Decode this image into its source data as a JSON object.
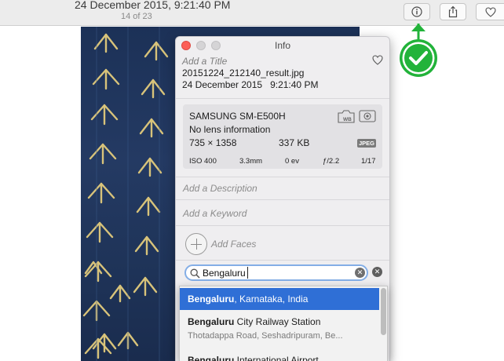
{
  "toolbar": {
    "date_title": "24 December 2015, 9:21:40 PM",
    "photo_count": "14 of 23",
    "info_icon": "info-icon",
    "share_icon": "share-icon",
    "favorite_icon": "heart-icon"
  },
  "info_panel": {
    "window_title": "Info",
    "add_title_placeholder": "Add a Title",
    "filename": "20151224_212140_result.jpg",
    "date": "24 December 2015   9:21:40 PM",
    "camera": {
      "model": "SAMSUNG SM-E500H",
      "lens": "No lens information",
      "dimensions": "735 × 1358",
      "file_size": "337 KB",
      "format": "JPEG",
      "iso": "ISO 400",
      "focal_length": "3.3mm",
      "exposure": "0 ev",
      "aperture": "ƒ/2.2",
      "shutter": "1/17"
    },
    "add_description_placeholder": "Add a Description",
    "add_keyword_placeholder": "Add a Keyword",
    "add_faces_label": "Add Faces",
    "location_search": {
      "value": "Bengaluru"
    }
  },
  "location_suggestions": [
    {
      "bold": "Bengaluru",
      "rest": ", Karnataka, India",
      "detail": ""
    },
    {
      "bold": "Bengaluru",
      "rest": " City Railway Station",
      "detail": "Thotadappa Road, Seshadripuram, Be..."
    },
    {
      "bold": "Bengaluru",
      "rest": " International Airport",
      "detail": ""
    }
  ],
  "colors": {
    "selection": "#2f6fd6",
    "annotation_green": "#22b33a",
    "close_red": "#fc5f57"
  }
}
